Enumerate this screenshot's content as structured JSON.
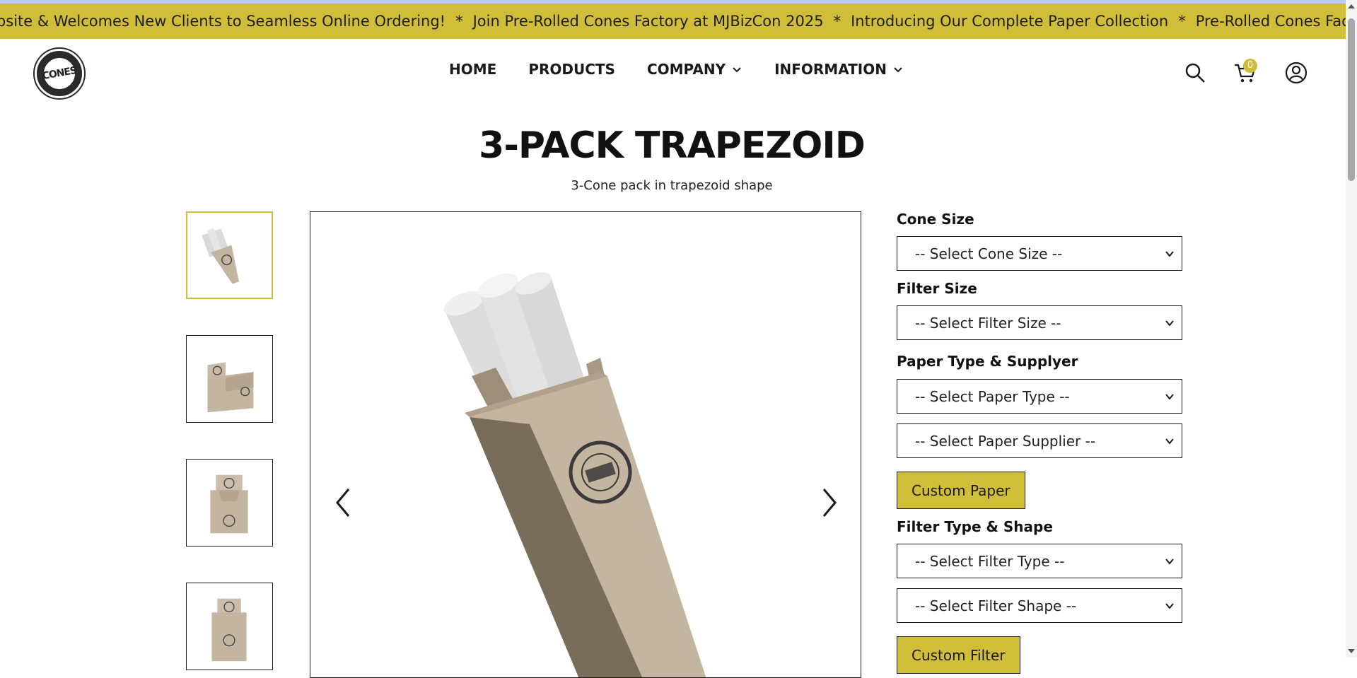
{
  "announcement": {
    "items": [
      "ebsite & Welcomes New Clients to Seamless Online Ordering!",
      "Join Pre-Rolled Cones Factory at MJBizCon 2025",
      "Introducing Our Complete Paper Collection",
      "Pre-Rolled Cones Factc"
    ],
    "separator": "*"
  },
  "header": {
    "logo_text": "CONES",
    "nav": {
      "home": "HOME",
      "products": "PRODUCTS",
      "company": "COMPANY",
      "information": "INFORMATION"
    },
    "cart_count": "0"
  },
  "product": {
    "title": "3-PACK TRAPEZOID",
    "subtitle": "3-Cone pack in trapezoid shape"
  },
  "options": {
    "cone_size_label": "Cone Size",
    "cone_size_value": "-- Select Cone Size --",
    "filter_size_label": "Filter Size",
    "filter_size_value": "-- Select Filter Size --",
    "paper_label": "Paper Type & Supplyer",
    "paper_type_value": "-- Select Paper Type --",
    "paper_supplier_value": "-- Select Paper Supplier --",
    "custom_paper": "Custom Paper",
    "filter_label": "Filter Type & Shape",
    "filter_type_value": "-- Select Filter Type --",
    "filter_shape_value": "-- Select Filter Shape --",
    "custom_filter": "Custom Filter"
  },
  "colors": {
    "accent": "#d1be38",
    "kraft": "#c4b5a1",
    "kraft_dark": "#7a6c5b"
  }
}
